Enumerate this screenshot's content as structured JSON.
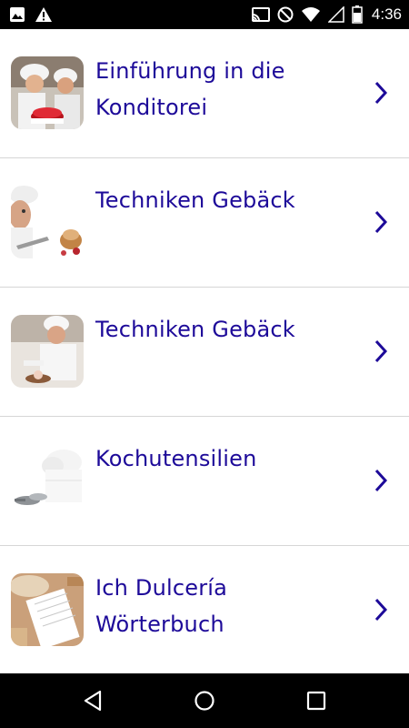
{
  "status_bar": {
    "time": "4:36",
    "left_icons": [
      "image-icon",
      "warning-icon"
    ],
    "right_icons": [
      "cast-icon",
      "do-not-disturb-icon",
      "wifi-icon",
      "cell-signal-icon",
      "battery-icon"
    ]
  },
  "list": {
    "items": [
      {
        "title": "Einführung in die Konditorei",
        "thumb_icon": "pastry-chefs-thumbnail"
      },
      {
        "title": "Techniken Gebäck",
        "thumb_icon": "chef-pastry-thumbnail"
      },
      {
        "title": "Techniken Gebäck",
        "thumb_icon": "chef-decorating-thumbnail"
      },
      {
        "title": "Kochutensilien",
        "thumb_icon": "chef-hat-utensils-thumbnail"
      },
      {
        "title": "Ich Dulcería Wörterbuch",
        "thumb_icon": "notebook-baking-thumbnail"
      }
    ],
    "accent_color": "#1d0a99"
  },
  "nav_bar": {
    "buttons": [
      "back-icon",
      "home-icon",
      "recents-icon"
    ]
  }
}
